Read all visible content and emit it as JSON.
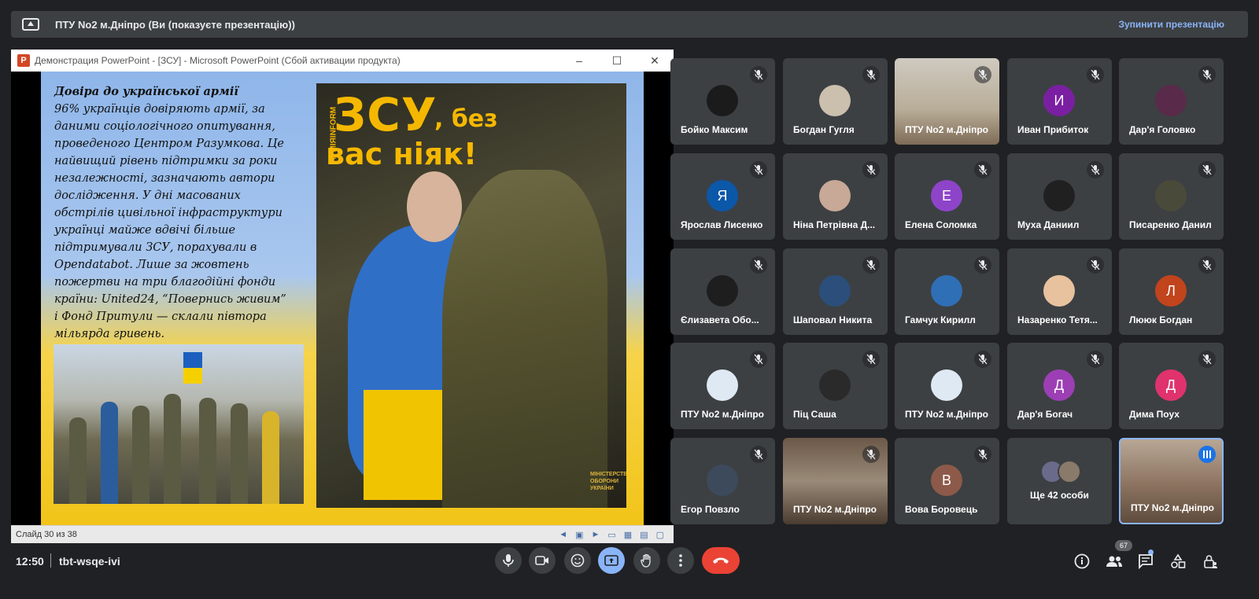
{
  "top_bar": {
    "title": "ПТУ No2 м.Дніпро (Ви (показуєте презентацію))",
    "stop_label": "Зупинити презентацію"
  },
  "presentation": {
    "window_title": "Демонстрация PowerPoint - [ЗСУ] - Microsoft PowerPoint (Сбой активации продукта)",
    "window_controls": [
      "–",
      "☐",
      "✕"
    ],
    "slide_heading": "Довіра до української армії",
    "slide_body": "96% українців довіряють армії, за даними соціологічного опитування, проведеного Центром Разумкова. Це найвищий рівень підтримки за роки незалежності, зазначають автори дослідження. У дні масованих обстрілів цивільної інфраструктури українці майже вдвічі більше підтримували ЗСУ, порахували в Opendatabot. Лише за жовтень пожертви на три благодійні фонди країни: United24, “Повернись живим” і Фонд Притули — склали півтора мільярда гривень.",
    "poster_line1": "ЗСУ",
    "poster_line1b": ", без",
    "poster_line2": "вас ніяк!",
    "poster_side": "АРМІЯINFORM",
    "poster_ministry": "МІНІСТЕРСТВО ОБОРОНИ УКРАЇНИ",
    "status_slide": "Слайд 30 из 38"
  },
  "participants": [
    {
      "name": "Бойко Максим",
      "kind": "photo",
      "color": "#1b1b1b"
    },
    {
      "name": "Богдан Гугля",
      "kind": "photo",
      "color": "#cbbfae"
    },
    {
      "name": "ПТУ No2 м.Дніпро",
      "kind": "video"
    },
    {
      "name": "Иван Прибиток",
      "kind": "letter",
      "letter": "И",
      "color": "#7b1fa2"
    },
    {
      "name": "Дар'я Головко",
      "kind": "photo",
      "color": "#5a2a4a"
    },
    {
      "name": "Ярослав Лисенко",
      "kind": "letter",
      "letter": "Я",
      "color": "#0b57a8"
    },
    {
      "name": "Ніна Петрівна Д...",
      "kind": "photo",
      "color": "#c8a896"
    },
    {
      "name": "Елена Соломка",
      "kind": "letter",
      "letter": "Е",
      "color": "#8e44c9"
    },
    {
      "name": "Муха Даниил",
      "kind": "photo",
      "color": "#202020"
    },
    {
      "name": "Писаренко Данил",
      "kind": "photo",
      "color": "#4a4a3a"
    },
    {
      "name": "Єлизавета Обо...",
      "kind": "photo",
      "color": "#1e1e1e"
    },
    {
      "name": "Шаповал Никита",
      "kind": "photo",
      "color": "#2b4f7a"
    },
    {
      "name": "Гамчук Кирилл",
      "kind": "photo",
      "color": "#2f6fb6"
    },
    {
      "name": "Назаренко Тетя...",
      "kind": "photo",
      "color": "#e8c29e"
    },
    {
      "name": "Лююк Богдан",
      "kind": "letter",
      "letter": "Л",
      "color": "#c1441d"
    },
    {
      "name": "ПТУ No2 м.Дніпро",
      "kind": "photo",
      "color": "#dfe9f4"
    },
    {
      "name": "Піц Саша",
      "kind": "photo",
      "color": "#2a2a2a"
    },
    {
      "name": "ПТУ No2 м.Дніпро",
      "kind": "photo",
      "color": "#dfe9f4"
    },
    {
      "name": "Дар'я Богач",
      "kind": "letter",
      "letter": "Д",
      "color": "#9c3fb5"
    },
    {
      "name": "Дима Поух",
      "kind": "letter",
      "letter": "Д",
      "color": "#e0336e"
    },
    {
      "name": "Егор Повзло",
      "kind": "photo",
      "color": "#3d4a5c"
    },
    {
      "name": "ПТУ No2 м.Дніпро",
      "kind": "video2"
    },
    {
      "name": "Вова Боровець",
      "kind": "letter",
      "letter": "В",
      "color": "#8d5a4a"
    },
    {
      "name": "Ще 42 особи",
      "kind": "more"
    },
    {
      "name": "ПТУ No2 м.Дніпро",
      "kind": "video3",
      "speaking": true
    }
  ],
  "bottom_bar": {
    "time": "12:50",
    "meeting_code": "tbt-wsqe-ivi",
    "people_count": "67"
  },
  "colors": {
    "background": "#202124",
    "tile": "#3c4043",
    "accent": "#8ab4f8",
    "end_call": "#ea4335"
  }
}
